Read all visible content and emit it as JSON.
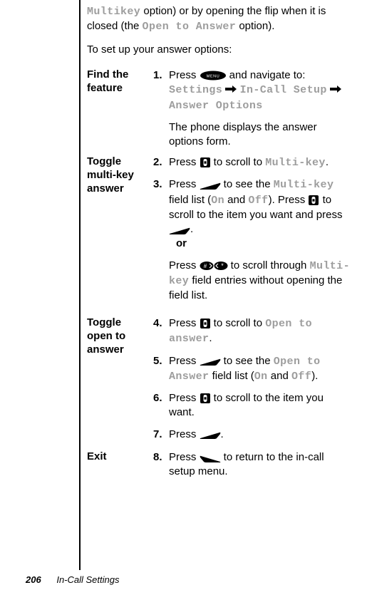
{
  "intro": {
    "part1_before": "",
    "mono1": "Multikey",
    "part1_after": " option) or by opening the flip when it is closed (the ",
    "mono2": "Open to Answer",
    "part1_end": " option)."
  },
  "lead": "To set up your answer options:",
  "sections": [
    {
      "heading": "Find the feature",
      "steps": [
        {
          "num": "1.",
          "parts": [
            {
              "t": "Press "
            },
            {
              "icon": "menu"
            },
            {
              "t": " and navigate to:"
            }
          ],
          "after": [
            {
              "type": "path",
              "segments": [
                "Settings",
                "In-Call Setup",
                "Answer Options"
              ]
            },
            {
              "type": "plain",
              "text": "The phone displays the answer options form."
            }
          ]
        }
      ]
    },
    {
      "heading": "Toggle multi-key answer",
      "steps": [
        {
          "num": "2.",
          "parts": [
            {
              "t": "Press "
            },
            {
              "icon": "nav"
            },
            {
              "t": " to scroll to "
            },
            {
              "mono": "Multi-key"
            },
            {
              "t": "."
            }
          ]
        },
        {
          "num": "3.",
          "parts": [
            {
              "t": "Press "
            },
            {
              "icon": "softright"
            },
            {
              "t": " to see the "
            },
            {
              "mono": "Multi-key"
            },
            {
              "t": " field list ("
            },
            {
              "mono": "On"
            },
            {
              "t": " and "
            },
            {
              "mono": "Off"
            },
            {
              "t": "). Press "
            },
            {
              "icon": "nav"
            },
            {
              "t": " to scroll to the item you want and press "
            },
            {
              "icon": "softright"
            },
            {
              "t": "."
            }
          ],
          "after": [
            {
              "type": "or",
              "text": "or"
            },
            {
              "type": "mixed",
              "parts": [
                {
                  "t": "Press "
                },
                {
                  "icon": "dualkeys"
                },
                {
                  "t": " to scroll through "
                },
                {
                  "mono": "Multi-key"
                },
                {
                  "t": " field entries without opening the field list."
                }
              ]
            }
          ]
        }
      ]
    },
    {
      "heading": "Toggle open to answer",
      "steps": [
        {
          "num": "4.",
          "parts": [
            {
              "t": "Press "
            },
            {
              "icon": "nav"
            },
            {
              "t": " to scroll to "
            },
            {
              "mono": "Open to answer"
            },
            {
              "t": "."
            }
          ]
        },
        {
          "num": "5.",
          "parts": [
            {
              "t": "Press "
            },
            {
              "icon": "softright"
            },
            {
              "t": " to see the "
            },
            {
              "mono": "Open to Answer"
            },
            {
              "t": " field list ("
            },
            {
              "mono": "On"
            },
            {
              "t": " and "
            },
            {
              "mono": "Off"
            },
            {
              "t": ")."
            }
          ]
        },
        {
          "num": "6.",
          "parts": [
            {
              "t": "Press "
            },
            {
              "icon": "nav"
            },
            {
              "t": " to scroll to the item you want."
            }
          ]
        },
        {
          "num": "7.",
          "parts": [
            {
              "t": "Press "
            },
            {
              "icon": "softright"
            },
            {
              "t": "."
            }
          ]
        }
      ]
    },
    {
      "heading": "Exit",
      "steps": [
        {
          "num": "8.",
          "parts": [
            {
              "t": "Press "
            },
            {
              "icon": "softleft"
            },
            {
              "t": " to return to the in-call setup menu."
            }
          ]
        }
      ]
    }
  ],
  "footer": {
    "page": "206",
    "title": "In-Call Settings"
  },
  "icons": {
    "menu_label": "MENU"
  }
}
